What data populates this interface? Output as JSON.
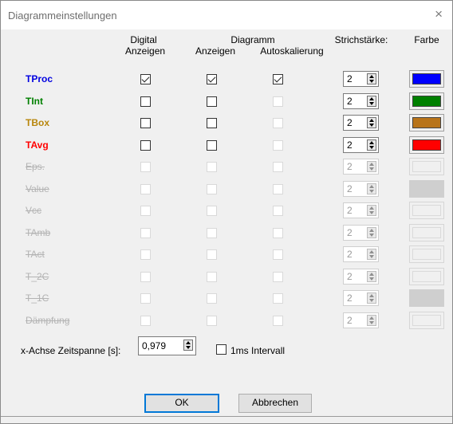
{
  "window": {
    "title": "Diagrammeinstellungen",
    "close_glyph": "×"
  },
  "headers": {
    "digital_line1": "Digital",
    "digital_line2": "Anzeigen",
    "diagramm": "Diagramm",
    "diagramm_anzeigen": "Anzeigen",
    "autoskalierung": "Autoskalierung",
    "strichstaerke": "Strichstärke:",
    "farbe": "Farbe"
  },
  "rows": [
    {
      "label": "TProc",
      "color": "#0000e0",
      "enabled": true,
      "digital": true,
      "anzeigen": true,
      "auto": true,
      "width": "2",
      "swatch": "#0000ff"
    },
    {
      "label": "TInt",
      "color": "#008000",
      "enabled": true,
      "digital": false,
      "anzeigen": false,
      "auto": false,
      "width": "2",
      "swatch": "#008000"
    },
    {
      "label": "TBox",
      "color": "#b8860b",
      "enabled": true,
      "digital": false,
      "anzeigen": false,
      "auto": false,
      "width": "2",
      "swatch": "#b8741a"
    },
    {
      "label": "TAvg",
      "color": "#ff0000",
      "enabled": true,
      "digital": false,
      "anzeigen": false,
      "auto": false,
      "width": "2",
      "swatch": "#ff0000"
    },
    {
      "label": "Eps.",
      "enabled": false,
      "width": "2",
      "swatch": "#f0f0f0"
    },
    {
      "label": "Value",
      "enabled": false,
      "width": "2",
      "swatch": "#cfcfcf"
    },
    {
      "label": "Vcc",
      "enabled": false,
      "width": "2",
      "swatch": "#f0f0f0"
    },
    {
      "label": "TAmb",
      "enabled": false,
      "width": "2",
      "swatch": "#f0f0f0"
    },
    {
      "label": "TAct",
      "enabled": false,
      "width": "2",
      "swatch": "#f0f0f0"
    },
    {
      "label": "T_2C",
      "enabled": false,
      "width": "2",
      "swatch": "#f0f0f0"
    },
    {
      "label": "T_1C",
      "enabled": false,
      "width": "2",
      "swatch": "#cfcfcf"
    },
    {
      "label": "Dämpfung",
      "enabled": false,
      "width": "2",
      "swatch": "#f0f0f0"
    }
  ],
  "zeitspanne": {
    "label": "x-Achse Zeitspanne [s]:",
    "value": "0,979"
  },
  "interval": {
    "label": "1ms Intervall",
    "checked": false
  },
  "buttons": {
    "ok": "OK",
    "cancel": "Abbrechen"
  }
}
